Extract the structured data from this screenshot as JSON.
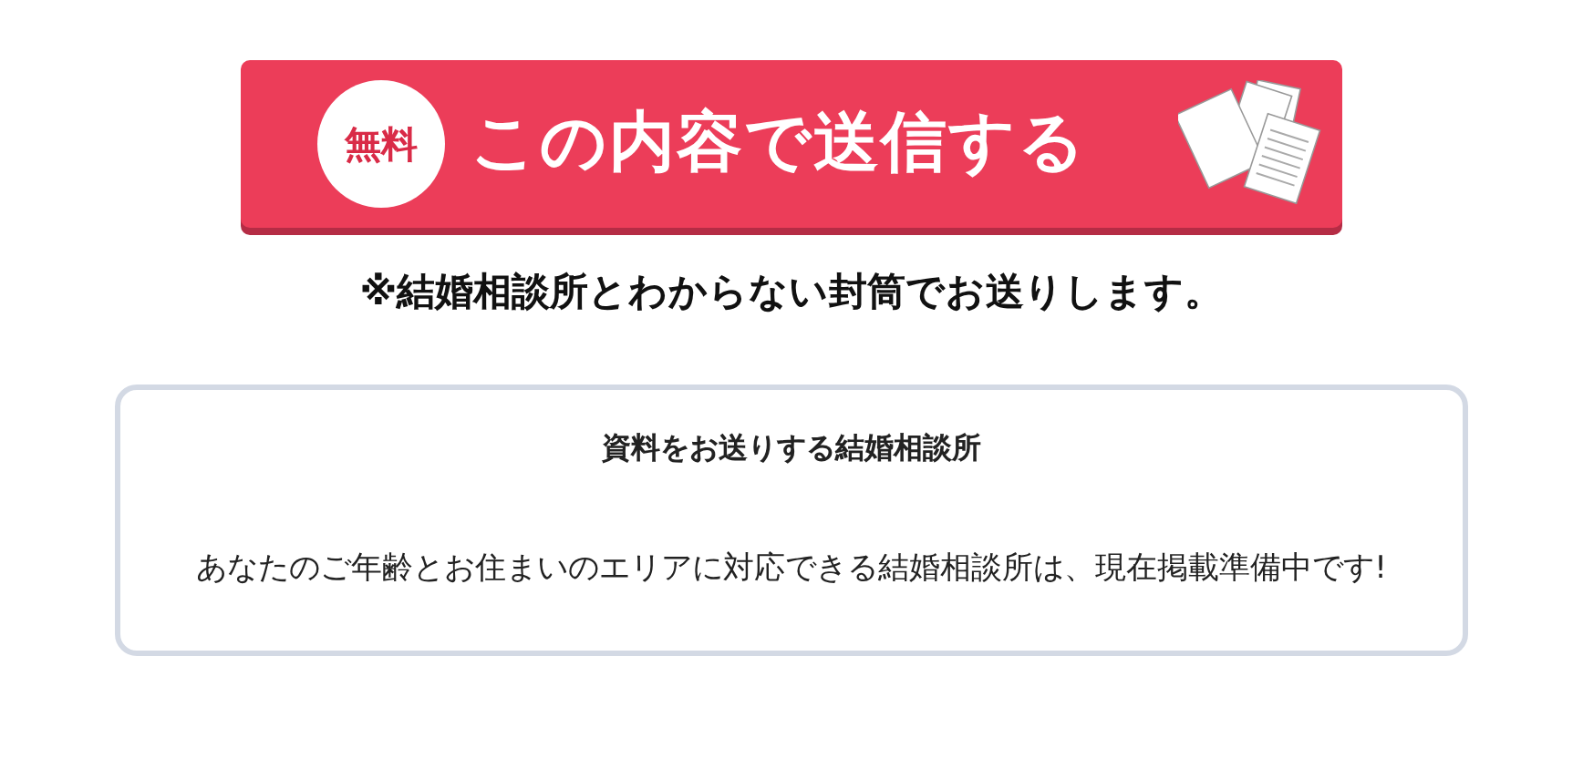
{
  "submit_button": {
    "badge": "無料",
    "label": "この内容で送信する"
  },
  "notice": "※結婚相談所とわからない封筒でお送りします。",
  "panel": {
    "title": "資料をお送りする結婚相談所",
    "message": "あなたのご年齢とお住まいのエリアに対応できる結婚相談所は、現在掲載準備中です!"
  }
}
